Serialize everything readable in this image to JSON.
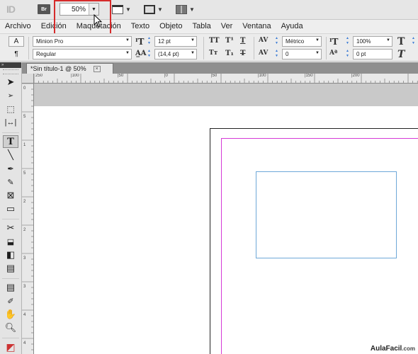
{
  "appbar": {
    "logo": "ID",
    "bridge_label": "Br",
    "zoom_value": "50%"
  },
  "menubar": {
    "items": [
      "Archivo",
      "Edición",
      "Maquetación",
      "Texto",
      "Objeto",
      "Tabla",
      "Ver",
      "Ventana",
      "Ayuda"
    ]
  },
  "control": {
    "font_family": "Minion Pro",
    "font_style": "Regular",
    "font_size": "12 pt",
    "leading": "(14,4 pt)",
    "kerning": "Métrico",
    "tracking": "0",
    "vertical_scale": "100%",
    "baseline_shift": "0 pt",
    "char_button": "A",
    "para_button": "¶"
  },
  "document_tab": {
    "title": "*Sin título-1 @ 50%",
    "close": "×"
  },
  "ruler_h_labels": [
    "250",
    "|100",
    "|50",
    "|0",
    "|50",
    "|100",
    "|150",
    "|200"
  ],
  "ruler_v_labels": [
    "0",
    "5",
    "1",
    "5",
    "2",
    "2",
    "3",
    "3",
    "4",
    "4"
  ],
  "watermark": {
    "brand": "AulaFacil",
    "suffix": ".com"
  },
  "colors": {
    "highlight": "#d62b2b",
    "margin_guide": "#d53ad6",
    "text_frame": "#6ea8d8"
  }
}
